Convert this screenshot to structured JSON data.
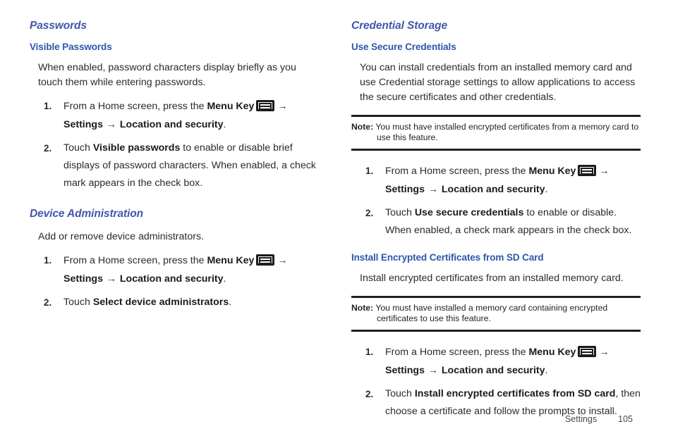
{
  "document": {
    "footer": {
      "section_label": "Settings",
      "page_number": "105"
    }
  },
  "icons": {
    "menu_key": "menu-key-icon",
    "arrow": "→"
  },
  "left_column": {
    "section_heading": "Passwords",
    "subsection_heading": "Visible Passwords",
    "intro": "When enabled, password characters display briefly as you touch them while entering passwords.",
    "steps": [
      {
        "num": "1.",
        "pre": "From a Home screen, press the ",
        "bold1": "Menu Key",
        "arrow1": "→",
        "bold2": "Settings",
        "arrow2": "→",
        "bold3": "Location and security",
        "post": "."
      },
      {
        "num": "2.",
        "pre": "Touch ",
        "bold1": "Visible passwords",
        "post": " to enable or disable brief displays of password characters. When enabled, a check mark appears in the check box."
      }
    ],
    "section2_heading": "Device Administration",
    "section2_intro": "Add or remove device administrators.",
    "section2_steps": [
      {
        "num": "1.",
        "pre": "From a Home screen, press the ",
        "bold1": "Menu Key",
        "arrow1": "→",
        "bold2": "Settings",
        "arrow2": "→",
        "bold3": "Location and security",
        "post": "."
      },
      {
        "num": "2.",
        "pre": "Touch ",
        "bold1": "Select device administrators",
        "post": "."
      }
    ]
  },
  "right_column": {
    "section_heading": "Credential Storage",
    "subsection_heading": "Use Secure Credentials",
    "intro": "You can install credentials from an installed memory card and use Credential storage settings to allow applications to access the secure certificates and other credentials.",
    "note1": {
      "label": "Note:",
      "text": "You must have installed encrypted certificates from a memory card to use this feature."
    },
    "steps": [
      {
        "num": "1.",
        "pre": "From a Home screen, press the ",
        "bold1": "Menu Key",
        "arrow1": "→",
        "bold2": "Settings",
        "arrow2": "→",
        "bold3": "Location and security",
        "post": "."
      },
      {
        "num": "2.",
        "pre": "Touch ",
        "bold1": "Use secure credentials",
        "post": " to enable or disable. When enabled, a check mark appears in the check box."
      }
    ],
    "subsection2_heading": "Install Encrypted Certificates from SD Card",
    "subsection2_intro": "Install encrypted certificates from an installed memory card.",
    "note2": {
      "label": "Note:",
      "text": "You must have installed a memory card containing encrypted certificates to use this feature."
    },
    "steps2": [
      {
        "num": "1.",
        "pre": "From a Home screen, press the ",
        "bold1": "Menu Key",
        "arrow1": "→",
        "bold2": "Settings",
        "arrow2": "→",
        "bold3": "Location and security",
        "post": "."
      },
      {
        "num": "2.",
        "pre": "Touch ",
        "bold1": "Install encrypted certificates from SD card",
        "post": ", then choose a certificate and follow the prompts to install."
      }
    ]
  },
  "colors": {
    "section_heading": "#4356a8",
    "subsection_heading": "#2d57a8",
    "body_text": "#2b2b2b",
    "rule": "#231f20"
  }
}
